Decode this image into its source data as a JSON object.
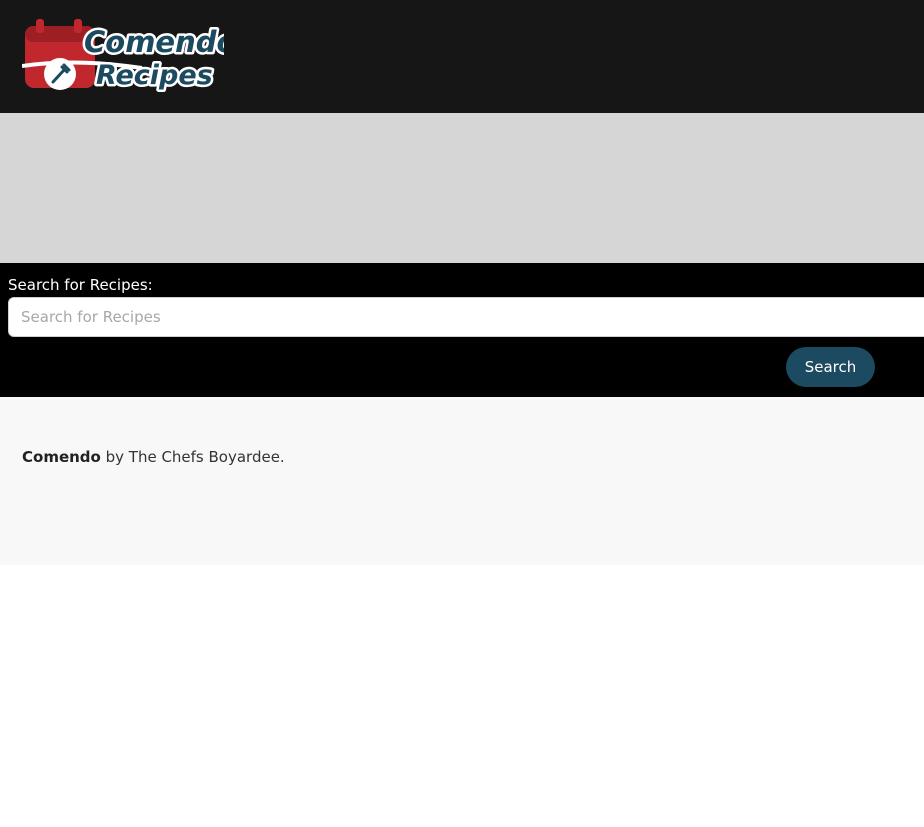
{
  "header": {
    "logo": {
      "text_line1": "Comendo",
      "text_line2": "Recipes",
      "icon": "calendar-fork-icon",
      "brand_color": "#1c4a60",
      "accent_color": "#c0282d"
    }
  },
  "search": {
    "label": "Search for Recipes:",
    "placeholder": "Search for Recipes",
    "value": "",
    "button_label": "Search"
  },
  "footer": {
    "brand": "Comendo",
    "suffix": " by The Chefs Boyardee."
  },
  "colors": {
    "navbar_bg": "#161616",
    "hero_bg": "#d6d6d6",
    "search_bg": "#000000",
    "button_bg": "#1c4a60",
    "footer_bg": "#f8f8f8"
  }
}
